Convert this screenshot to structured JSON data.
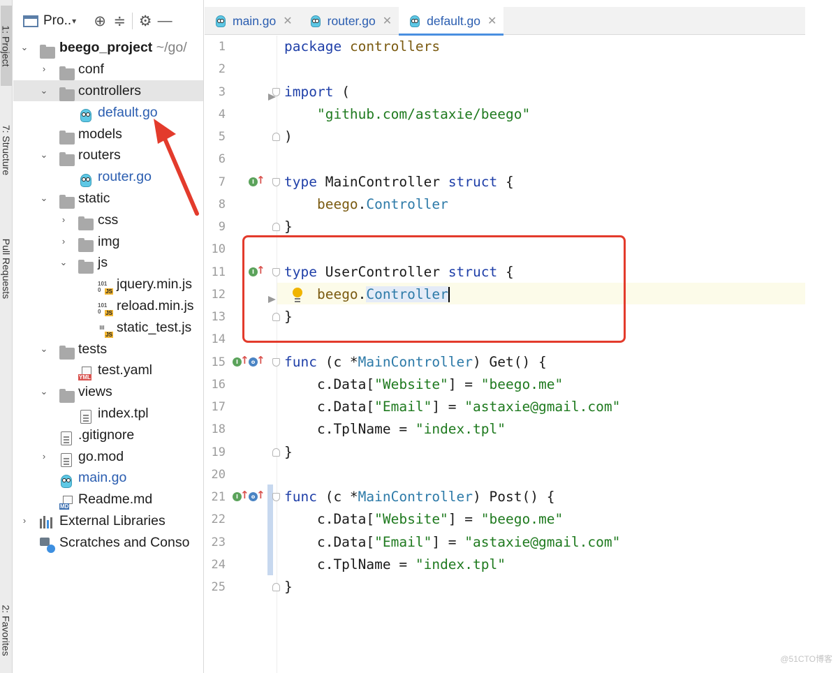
{
  "tool_strip": {
    "tabs": [
      {
        "label": "1: Project"
      },
      {
        "label": "7: Structure"
      },
      {
        "label": "Pull Requests"
      },
      {
        "label": "2: Favorites"
      }
    ]
  },
  "project_panel": {
    "title": "Pro..",
    "toolbar_icons": [
      "crosshair-icon",
      "collapse-icon",
      "gear-icon",
      "minimize-icon"
    ],
    "tree": [
      {
        "label": "beego_project",
        "hint": "~/go/",
        "icon": "folder-icon",
        "expanded": true
      },
      {
        "label": "conf",
        "icon": "folder-icon",
        "expanded": false
      },
      {
        "label": "controllers",
        "icon": "folder-icon",
        "expanded": true
      },
      {
        "label": "default.go",
        "icon": "go-file-icon"
      },
      {
        "label": "models",
        "icon": "folder-icon"
      },
      {
        "label": "routers",
        "icon": "folder-icon",
        "expanded": true
      },
      {
        "label": "router.go",
        "icon": "go-file-icon"
      },
      {
        "label": "static",
        "icon": "folder-icon",
        "expanded": true
      },
      {
        "label": "css",
        "icon": "folder-icon",
        "expanded": false
      },
      {
        "label": "img",
        "icon": "folder-icon",
        "expanded": false
      },
      {
        "label": "js",
        "icon": "folder-icon",
        "expanded": true
      },
      {
        "label": "jquery.min.js",
        "icon": "minified-js-icon"
      },
      {
        "label": "reload.min.js",
        "icon": "minified-js-icon"
      },
      {
        "label": "static_test.js",
        "icon": "js-file-icon"
      },
      {
        "label": "tests",
        "icon": "folder-icon",
        "expanded": true
      },
      {
        "label": "test.yaml",
        "icon": "yaml-file-icon"
      },
      {
        "label": "views",
        "icon": "folder-icon",
        "expanded": true
      },
      {
        "label": "index.tpl",
        "icon": "text-file-icon"
      },
      {
        "label": ".gitignore",
        "icon": "ignored-file-icon"
      },
      {
        "label": "go.mod",
        "icon": "text-file-icon",
        "expanded": false
      },
      {
        "label": "main.go",
        "icon": "go-file-icon"
      },
      {
        "label": "Readme.md",
        "icon": "markdown-file-icon"
      },
      {
        "label": "External Libraries",
        "icon": "library-icon",
        "expanded": false
      },
      {
        "label": "Scratches and Conso",
        "icon": "scratches-icon"
      }
    ]
  },
  "editor": {
    "tabs": [
      {
        "label": "main.go",
        "icon": "go-file-icon",
        "active": false
      },
      {
        "label": "router.go",
        "icon": "go-file-icon",
        "active": false
      },
      {
        "label": "default.go",
        "icon": "go-file-icon",
        "active": true
      }
    ],
    "lines": [
      {
        "n": "1",
        "code": "package controllers"
      },
      {
        "n": "2",
        "code": ""
      },
      {
        "n": "3",
        "code": "import ("
      },
      {
        "n": "4",
        "code": "    \"github.com/astaxie/beego\""
      },
      {
        "n": "5",
        "code": ")"
      },
      {
        "n": "6",
        "code": ""
      },
      {
        "n": "7",
        "code": "type MainController struct {"
      },
      {
        "n": "8",
        "code": "    beego.Controller"
      },
      {
        "n": "9",
        "code": "}"
      },
      {
        "n": "10",
        "code": ""
      },
      {
        "n": "11",
        "code": "type UserController struct {"
      },
      {
        "n": "12",
        "code": "    beego.Controller"
      },
      {
        "n": "13",
        "code": "}"
      },
      {
        "n": "14",
        "code": ""
      },
      {
        "n": "15",
        "code": "func (c *MainController) Get() {"
      },
      {
        "n": "16",
        "code": "    c.Data[\"Website\"] = \"beego.me\""
      },
      {
        "n": "17",
        "code": "    c.Data[\"Email\"] = \"astaxie@gmail.com\""
      },
      {
        "n": "18",
        "code": "    c.TplName = \"index.tpl\""
      },
      {
        "n": "19",
        "code": "}"
      },
      {
        "n": "20",
        "code": ""
      },
      {
        "n": "21",
        "code": "func (c *MainController) Post() {"
      },
      {
        "n": "22",
        "code": "    c.Data[\"Website\"] = \"beego.me\""
      },
      {
        "n": "23",
        "code": "    c.Data[\"Email\"] = \"astaxie@gmail.com\""
      },
      {
        "n": "24",
        "code": "    c.TplName = \"index.tpl\""
      },
      {
        "n": "25",
        "code": "}"
      }
    ],
    "cursor_line": "12"
  },
  "colors": {
    "keyword": "#1f3fa8",
    "string": "#1f7a1f",
    "package": "#7a5a10",
    "type": "#2d7aa8",
    "annotation": "#e33b2c",
    "selection": "#e4ebf7"
  },
  "watermark": "@51CTO博客"
}
